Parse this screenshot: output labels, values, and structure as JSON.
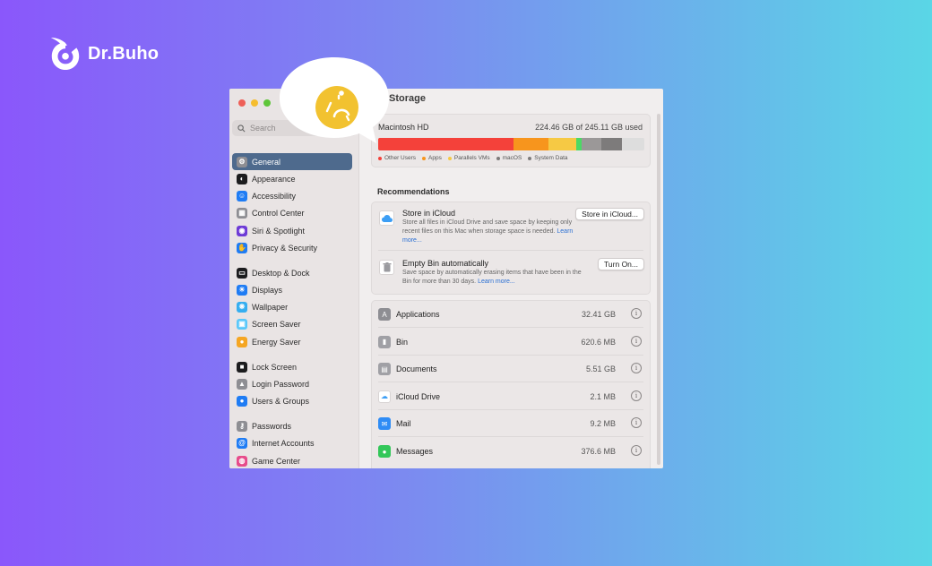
{
  "brand": {
    "name": "Dr.Buho"
  },
  "colors": {
    "accent_active": "#4e6a8d",
    "bg_left": "#8a57fb",
    "bg_right": "#5ad6e6"
  },
  "sidebar": {
    "search_placeholder": "Search",
    "items": [
      {
        "label": "General",
        "icon": "gear-icon",
        "color": "#8e8e93",
        "active": true
      },
      {
        "label": "Appearance",
        "icon": "appearance-icon",
        "color": "#1c1c1e"
      },
      {
        "label": "Accessibility",
        "icon": "accessibility-icon",
        "color": "#1f7cf4"
      },
      {
        "label": "Control Center",
        "icon": "control-center-icon",
        "color": "#8e8e93"
      },
      {
        "label": "Siri & Spotlight",
        "icon": "siri-icon",
        "color": "#6e3bd6"
      },
      {
        "label": "Privacy & Security",
        "icon": "hand-icon",
        "color": "#1f7cf4"
      },
      {
        "label": "Desktop & Dock",
        "icon": "dock-icon",
        "color": "#1c1c1e"
      },
      {
        "label": "Displays",
        "icon": "sun-icon",
        "color": "#1f7cf4"
      },
      {
        "label": "Wallpaper",
        "icon": "wallpaper-icon",
        "color": "#35aef0"
      },
      {
        "label": "Screen Saver",
        "icon": "screen-saver-icon",
        "color": "#5ac8fa"
      },
      {
        "label": "Energy Saver",
        "icon": "bulb-icon",
        "color": "#f5a623"
      },
      {
        "label": "Lock Screen",
        "icon": "lock-icon",
        "color": "#1c1c1e"
      },
      {
        "label": "Login Password",
        "icon": "padlock-icon",
        "color": "#8e8e93"
      },
      {
        "label": "Users & Groups",
        "icon": "users-icon",
        "color": "#1f7cf4"
      },
      {
        "label": "Passwords",
        "icon": "key-icon",
        "color": "#8e8e93"
      },
      {
        "label": "Internet Accounts",
        "icon": "at-icon",
        "color": "#1f7cf4"
      },
      {
        "label": "Game Center",
        "icon": "game-center-icon",
        "color": "#e74c8b"
      }
    ]
  },
  "main": {
    "title": "Storage",
    "disk": {
      "name": "Macintosh HD",
      "used_text": "224.46 GB of 245.11 GB used",
      "segments": [
        {
          "name": "Other Users",
          "color": "#f4413a",
          "fraction": 0.51
        },
        {
          "name": "Apps",
          "color": "#f7951d",
          "fraction": 0.13
        },
        {
          "name": "Parallels VMs",
          "color": "#f6c944",
          "fraction": 0.105
        },
        {
          "name": "green",
          "color": "#4cd964",
          "fraction": 0.02
        },
        {
          "name": "macOS",
          "color": "#9b9898",
          "fraction": 0.075
        },
        {
          "name": "System Data",
          "color": "#7d7b7b",
          "fraction": 0.075
        }
      ],
      "legend": [
        {
          "label": "Other Users",
          "color": "#f4413a"
        },
        {
          "label": "Apps",
          "color": "#f7951d"
        },
        {
          "label": "Parallels VMs",
          "color": "#f6c944"
        },
        {
          "label": "macOS",
          "color": "#7d7b7b"
        },
        {
          "label": "System Data",
          "color": "#7d7b7b"
        }
      ]
    },
    "recommendations": {
      "title": "Recommendations",
      "items": [
        {
          "title": "Store in iCloud",
          "desc": "Store all files in iCloud Drive and save space by keeping only recent files on this Mac when storage space is needed.",
          "link": "Learn more...",
          "button": "Store in iCloud..."
        },
        {
          "title": "Empty Bin automatically",
          "desc": "Save space by automatically erasing items that have been in the Bin for more than 30 days.",
          "link": "Learn more...",
          "button": "Turn On..."
        }
      ]
    },
    "categories": [
      {
        "name": "Applications",
        "size": "32.41 GB",
        "icon": "applications-icon",
        "color": "#8e8e93"
      },
      {
        "name": "Bin",
        "size": "620.6 MB",
        "icon": "bin-icon",
        "color": "#a0a0a5"
      },
      {
        "name": "Documents",
        "size": "5.51 GB",
        "icon": "document-icon",
        "color": "#a0a0a5"
      },
      {
        "name": "iCloud Drive",
        "size": "2.1 MB",
        "icon": "icloud-icon",
        "color": "#ffffff"
      },
      {
        "name": "Mail",
        "size": "9.2 MB",
        "icon": "mail-icon",
        "color": "#2f8cf5"
      },
      {
        "name": "Messages",
        "size": "376.6 MB",
        "icon": "messages-icon",
        "color": "#33c759"
      }
    ]
  }
}
